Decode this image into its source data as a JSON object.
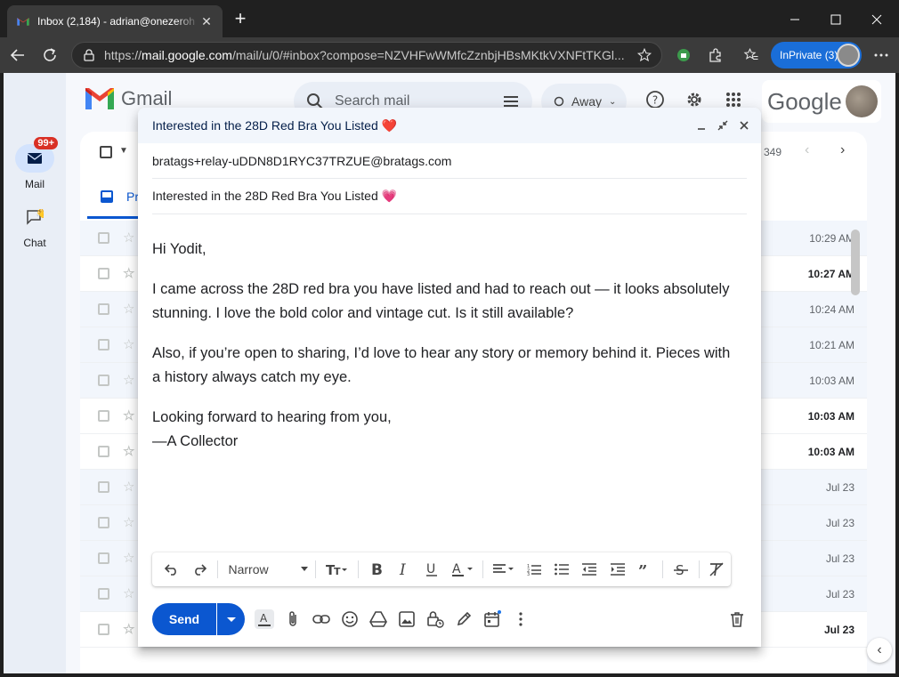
{
  "browser": {
    "tab_title": "Inbox (2,184) - adrian@onezeroh",
    "url_prefix": "https://",
    "url_host": "mail.google.com",
    "url_path": "/mail/u/0/#inbox?compose=NZVHFwWMfcZznbjHBsMKtkVXNFtTKGl...",
    "inprivate_label": "InPrivate (3)"
  },
  "gmail": {
    "logo_text": "Gmail",
    "search_placeholder": "Search mail",
    "status_label": "Away",
    "google_label": "Google",
    "rail": [
      {
        "label": "Mail",
        "badge": "99+"
      },
      {
        "label": "Chat"
      }
    ],
    "tab_label": "Pr",
    "pager": "349",
    "row_times": [
      {
        "time": "10:29 AM",
        "unread": false
      },
      {
        "time": "10:27 AM",
        "unread": true
      },
      {
        "time": "10:24 AM",
        "unread": false
      },
      {
        "time": "10:21 AM",
        "unread": false
      },
      {
        "time": "10:03 AM",
        "unread": false
      },
      {
        "time": "10:03 AM",
        "unread": true
      },
      {
        "time": "10:03 AM",
        "unread": true
      },
      {
        "time": "Jul 23",
        "unread": false
      },
      {
        "time": "Jul 23",
        "unread": false
      },
      {
        "time": "Jul 23",
        "unread": false
      },
      {
        "time": "Jul 23",
        "unread": false
      },
      {
        "time": "Jul 23",
        "unread": true
      }
    ]
  },
  "compose": {
    "header_title": "Interested in the 28D Red Bra You Listed ❤️",
    "to": "bratags+relay-uDDN8D1RYC37TRZUE@bratags.com",
    "subject": "Interested in the 28D Red Bra You Listed 💗",
    "body": {
      "greeting": "Hi Yodit,",
      "p1": "I came across the 28D red bra you have listed and had to reach out — it looks absolutely stunning. I love the bold color and vintage cut. Is it still available?",
      "p2": "Also, if you’re open to sharing, I’d love to hear any story or memory behind it. Pieces with a history always catch my eye.",
      "closing": "Looking forward to hearing from you,",
      "signature": "—A Collector"
    },
    "format_font": "Narrow",
    "send_label": "Send"
  }
}
